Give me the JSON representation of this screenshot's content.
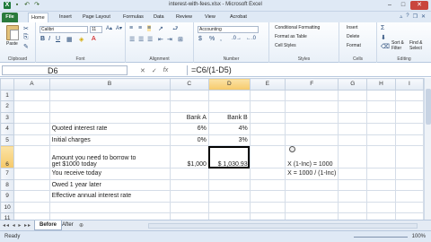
{
  "window": {
    "title": "interest-with-fees.xlsx - Microsoft Excel"
  },
  "tabs": [
    "File",
    "Home",
    "Insert",
    "Page Layout",
    "Formulas",
    "Data",
    "Review",
    "View",
    "Acrobat"
  ],
  "ribbon": {
    "clipboard": {
      "label": "Clipboard",
      "paste": "Paste"
    },
    "font": {
      "label": "Font",
      "font_name": "Calibri",
      "font_size": "11"
    },
    "alignment": {
      "label": "Alignment"
    },
    "number": {
      "label": "Number",
      "format": "Accounting",
      "currency": "$",
      "percent": "%",
      "comma": ","
    },
    "styles": {
      "label": "Styles",
      "conditional": "Conditional Formatting",
      "format_table": "Format as Table",
      "cell_styles": "Cell Styles"
    },
    "cells": {
      "label": "Cells",
      "insert": "Insert",
      "delete": "Delete",
      "format": "Format"
    },
    "editing": {
      "label": "Editing",
      "sigma": "Σ",
      "sort": "Sort & Filter",
      "find": "Find & Select"
    }
  },
  "formula_bar": {
    "name_box": "D6",
    "fx": "fx",
    "formula": "=C6/(1-D5)"
  },
  "columns": [
    "A",
    "B",
    "C",
    "D",
    "E",
    "F",
    "G",
    "H",
    "I"
  ],
  "selected_column": "D",
  "selected_row": "6",
  "rows": [
    {
      "n": "1",
      "B": "",
      "C": "",
      "D": "",
      "F": ""
    },
    {
      "n": "2",
      "B": "",
      "C": "",
      "D": "",
      "F": ""
    },
    {
      "n": "3",
      "B": "",
      "C": "Bank A",
      "D": "Bank B",
      "F": ""
    },
    {
      "n": "4",
      "B": "Quoted interest rate",
      "C": "6%",
      "D": "4%",
      "F": ""
    },
    {
      "n": "5",
      "B": "Initial charges",
      "C": "0%",
      "D": "3%",
      "F": ""
    },
    {
      "n": "6",
      "B1": "Amount you need to borrow to",
      "B": "get $1000 today",
      "C": "$1,000",
      "D": "$ 1,030.93",
      "F": "X (1-Inc) = 1000"
    },
    {
      "n": "7",
      "B": "You receive today",
      "C": "",
      "D": "",
      "F": "X = 1000 / (1-Inc)"
    },
    {
      "n": "8",
      "B": "Owed 1 year later",
      "C": "",
      "D": "",
      "F": ""
    },
    {
      "n": "9",
      "B": "Effective annual interest rate",
      "C": "",
      "D": "",
      "F": ""
    },
    {
      "n": "10",
      "B": "",
      "C": "",
      "D": "",
      "F": ""
    },
    {
      "n": "11",
      "B": "",
      "C": "",
      "D": "",
      "F": ""
    }
  ],
  "sheets": [
    "Before",
    "After"
  ],
  "status": {
    "ready": "Ready",
    "zoom": "100%"
  }
}
